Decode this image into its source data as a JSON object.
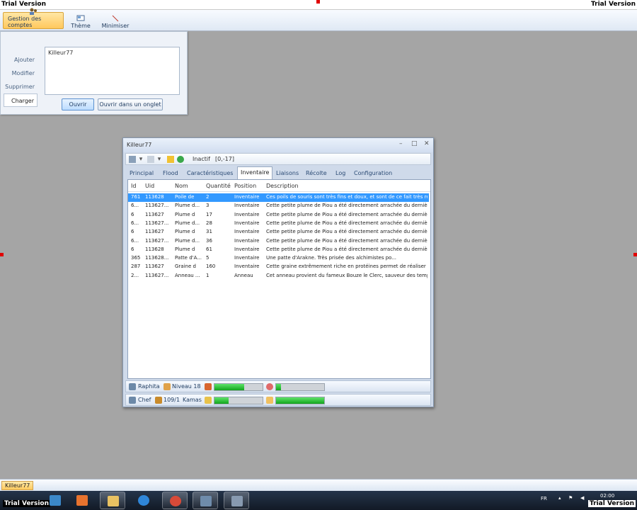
{
  "watermark": {
    "text": "Trial Version"
  },
  "ribbon": {
    "buttons": [
      {
        "label": "Gestion des comptes",
        "icon": "accounts-icon"
      },
      {
        "label": "Thème",
        "icon": "theme-icon"
      },
      {
        "label": "Minimiser",
        "icon": "minimize-icon"
      }
    ]
  },
  "account_panel": {
    "menu": [
      "Ajouter",
      "Modifier",
      "Supprimer",
      "Charger"
    ],
    "selected_menu": "Charger",
    "list_items": [
      "Killeur77"
    ],
    "open_button": "Ouvrir",
    "open_in_tab_button": "Ouvrir dans un onglet"
  },
  "window": {
    "title": "Killeur77",
    "controls": {
      "minimize": "–",
      "maximize": "□",
      "close": "✕"
    },
    "toolbar": {
      "status": "Inactif",
      "coords": "[0,-17]"
    },
    "tabs": [
      "Principal",
      "Flood",
      "Caractéristiques",
      "Inventaire",
      "Liaisons",
      "Récolte",
      "Log",
      "Configuration"
    ],
    "active_tab": "Inventaire",
    "columns": [
      "Id",
      "Uid",
      "Nom",
      "Quantité",
      "Position",
      "Description"
    ],
    "rows": [
      {
        "id": "761",
        "uid": "113628",
        "nom": "Poile de",
        "qty": "2",
        "pos": "Inventaire",
        "desc": "Ces poils de souris sont très fins et doux, et sont de ce fait très rec"
      },
      {
        "id": "6...",
        "uid": "113627...",
        "nom": "Plume d...",
        "qty": "3",
        "pos": "Inventaire",
        "desc": "Cette petite plume de Piou a été directement arrachée du dernière ..."
      },
      {
        "id": "6",
        "uid": "113627",
        "nom": "Plume d",
        "qty": "17",
        "pos": "Inventaire",
        "desc": "Cette petite plume de Piou a été directement arrachée du dernière"
      },
      {
        "id": "6...",
        "uid": "113627...",
        "nom": "Plume d...",
        "qty": "28",
        "pos": "Inventaire",
        "desc": "Cette petite plume de Piou a été directement arrachée du dernière ..."
      },
      {
        "id": "6",
        "uid": "113627",
        "nom": "Plume d",
        "qty": "31",
        "pos": "Inventaire",
        "desc": "Cette petite plume de Piou a été directement arrachée du dernière"
      },
      {
        "id": "6...",
        "uid": "113627...",
        "nom": "Plume d...",
        "qty": "36",
        "pos": "Inventaire",
        "desc": "Cette petite plume de Piou a été directement arrachée du dernière ..."
      },
      {
        "id": "6",
        "uid": "113628",
        "nom": "Plume d",
        "qty": "61",
        "pos": "Inventaire",
        "desc": "Cette petite plume de Piou a été directement arrachée du dernière"
      },
      {
        "id": "365",
        "uid": "113628...",
        "nom": "Patte d'A...",
        "qty": "5",
        "pos": "Inventaire",
        "desc": "Une patte d'Arakne. Très prisée des alchimistes po..."
      },
      {
        "id": "287",
        "uid": "113627",
        "nom": "Graine d",
        "qty": "160",
        "pos": "Inventaire",
        "desc": "Cette graine extrêmement riche en protéines permet de réaliser de"
      },
      {
        "id": "2...",
        "uid": "113627...",
        "nom": "Anneau ...",
        "qty": "1",
        "pos": "Anneau",
        "desc": "Cet anneau provient du fameux Bouze le Clerc, sauveur des temp..."
      }
    ],
    "status1": {
      "name": "Raphita",
      "level": "Niveau 18",
      "hp_fraction": 0.62,
      "xp_fraction": 0.1
    },
    "status2": {
      "state": "Chef",
      "pods": "109/1",
      "kamas": "Kamas",
      "energy_fraction": 0.3,
      "job_fraction": 1.0
    }
  },
  "bottom_tab": {
    "label": "Killeur77"
  },
  "taskbar": {
    "lang": "FR",
    "time": "02:00"
  }
}
